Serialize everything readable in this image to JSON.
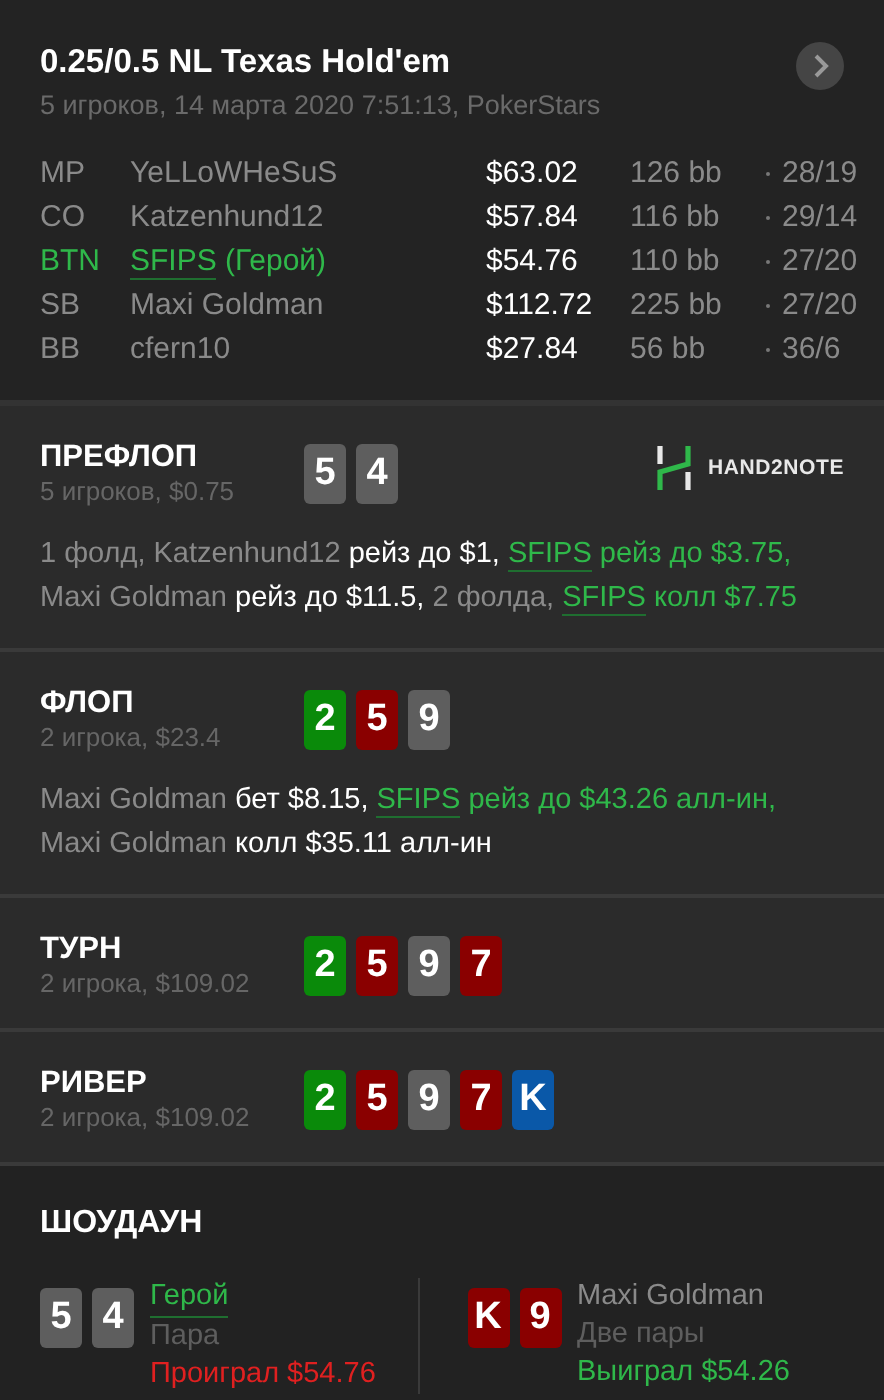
{
  "header": {
    "title": "0.25/0.5 NL Texas Hold'em",
    "subtitle": "5 игроков, 14 марта 2020 7:51:13, PokerStars"
  },
  "players": [
    {
      "position": "MP",
      "name": "YeLLoWHeSuS",
      "hero": false,
      "stack": "$63.02",
      "bb": "126 bb",
      "stats": "28/19"
    },
    {
      "position": "CO",
      "name": "Katzenhund12",
      "hero": false,
      "stack": "$57.84",
      "bb": "116 bb",
      "stats": "29/14"
    },
    {
      "position": "BTN",
      "name": "SFIPS",
      "hero_tag": "(Герой)",
      "hero": true,
      "stack": "$54.76",
      "bb": "110 bb",
      "stats": "27/20"
    },
    {
      "position": "SB",
      "name": "Maxi Goldman",
      "hero": false,
      "stack": "$112.72",
      "bb": "225 bb",
      "stats": "27/20"
    },
    {
      "position": "BB",
      "name": "cfern10",
      "hero": false,
      "stack": "$27.84",
      "bb": "56 bb",
      "stats": "36/6"
    }
  ],
  "streets": [
    {
      "name": "ПРЕФЛОП",
      "info": "5 игроков, $0.75",
      "logo": "HAND2NOTE",
      "cards": [
        {
          "rank": "5",
          "color": "#5e5e5e"
        },
        {
          "rank": "4",
          "color": "#5e5e5e"
        }
      ],
      "actions": [
        {
          "kind": "muted",
          "text": "1 фолд, Katzenhund12 "
        },
        {
          "kind": "action",
          "text": "рейз до $1, "
        },
        {
          "kind": "hero",
          "text": "SFIPS"
        },
        {
          "kind": "hero_action",
          "text": " рейз до $3.75, "
        },
        {
          "kind": "muted",
          "text": "Maxi Goldman "
        },
        {
          "kind": "action",
          "text": "рейз до $11.5, "
        },
        {
          "kind": "muted",
          "text": "2 фолда, "
        },
        {
          "kind": "hero",
          "text": "SFIPS"
        },
        {
          "kind": "hero_action",
          "text": " колл $7.75"
        }
      ]
    },
    {
      "name": "ФЛОП",
      "info": "2 игрока, $23.4",
      "cards": [
        {
          "rank": "2",
          "color": "#0a8a0a"
        },
        {
          "rank": "5",
          "color": "#8a0000"
        },
        {
          "rank": "9",
          "color": "#5e5e5e"
        }
      ],
      "actions": [
        {
          "kind": "muted",
          "text": "Maxi Goldman "
        },
        {
          "kind": "action",
          "text": "бет $8.15, "
        },
        {
          "kind": "hero",
          "text": "SFIPS"
        },
        {
          "kind": "hero_action",
          "text": " рейз до $43.26 алл-ин, "
        },
        {
          "kind": "muted",
          "text": "Maxi Goldman "
        },
        {
          "kind": "action",
          "text": "колл $35.11 алл-ин"
        }
      ]
    },
    {
      "name": "ТУРН",
      "info": "2 игрока, $109.02",
      "cards": [
        {
          "rank": "2",
          "color": "#0a8a0a"
        },
        {
          "rank": "5",
          "color": "#8a0000"
        },
        {
          "rank": "9",
          "color": "#5e5e5e"
        },
        {
          "rank": "7",
          "color": "#8a0000"
        }
      ]
    },
    {
      "name": "РИВЕР",
      "info": "2 игрока, $109.02",
      "cards": [
        {
          "rank": "2",
          "color": "#0a8a0a"
        },
        {
          "rank": "5",
          "color": "#8a0000"
        },
        {
          "rank": "9",
          "color": "#5e5e5e"
        },
        {
          "rank": "7",
          "color": "#8a0000"
        },
        {
          "rank": "K",
          "color": "#0a58a8"
        }
      ]
    }
  ],
  "showdown": {
    "title": "ШОУДАУН",
    "hands": [
      {
        "name": "Герой",
        "hero": true,
        "hand": "Пара",
        "result": "Проиграл $54.76",
        "won": false,
        "cards": [
          {
            "rank": "5",
            "color": "#5e5e5e"
          },
          {
            "rank": "4",
            "color": "#5e5e5e"
          }
        ]
      },
      {
        "name": "Maxi Goldman",
        "hero": false,
        "hand": "Две пары",
        "result": "Выиграл $54.26",
        "won": true,
        "cards": [
          {
            "rank": "K",
            "color": "#8a0000"
          },
          {
            "rank": "9",
            "color": "#8a0000"
          }
        ]
      }
    ]
  }
}
